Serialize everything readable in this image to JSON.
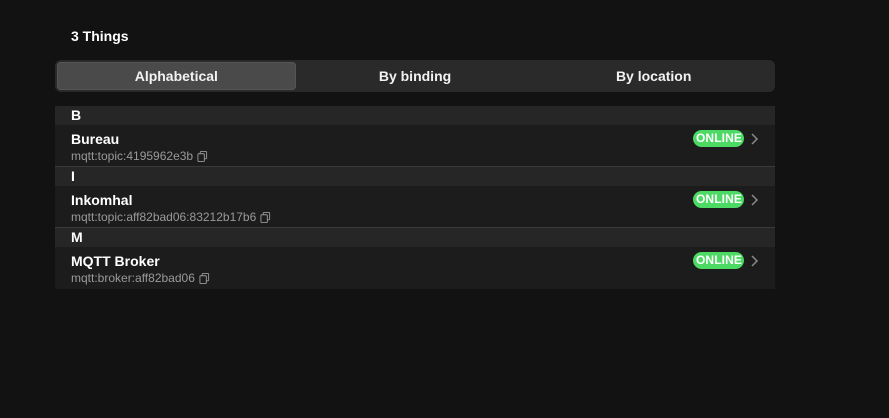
{
  "header": {
    "title": "3 Things"
  },
  "segments": [
    {
      "label": "Alphabetical",
      "active": true
    },
    {
      "label": "By binding",
      "active": false
    },
    {
      "label": "By location",
      "active": false
    }
  ],
  "groups": [
    {
      "letter": "B",
      "items": [
        {
          "title": "Bureau",
          "uid": "mqtt:topic:4195962e3b",
          "status": "ONLINE"
        }
      ]
    },
    {
      "letter": "I",
      "items": [
        {
          "title": "Inkomhal",
          "uid": "mqtt:topic:aff82bad06:83212b17b6",
          "status": "ONLINE"
        }
      ]
    },
    {
      "letter": "M",
      "items": [
        {
          "title": "MQTT Broker",
          "uid": "mqtt:broker:aff82bad06",
          "status": "ONLINE"
        }
      ]
    }
  ],
  "colors": {
    "background": "#121212",
    "online_badge": "#4cd964",
    "segment_active": "#4a4a4a"
  },
  "icons": {
    "copy": "copy-icon",
    "chevron": "chevron-right-icon"
  }
}
